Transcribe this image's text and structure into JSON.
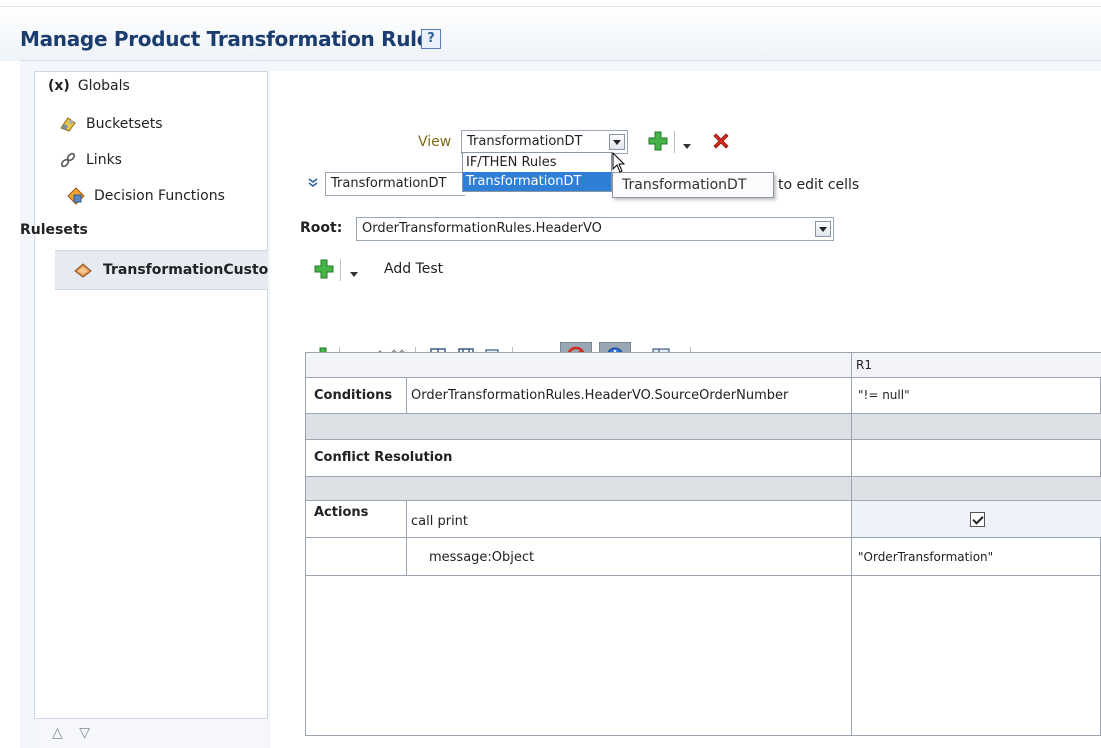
{
  "page": {
    "title": "Manage Product Transformation Rules",
    "help_label": "?"
  },
  "sidebar": {
    "items": [
      {
        "label": "Globals",
        "icon": "globals-icon"
      },
      {
        "label": "Bucketsets",
        "icon": "bucketsets-icon"
      },
      {
        "label": "Links",
        "icon": "links-icon"
      },
      {
        "label": "Decision Functions",
        "icon": "decision-functions-icon"
      }
    ],
    "rulesets_header": "Rulesets",
    "ruleset_item": "TransformationCusto",
    "globals_prefix": "(x)",
    "bottom_controls": "△ ▽"
  },
  "view": {
    "label": "View",
    "selected": "TransformationDT",
    "options": [
      "IF/THEN Rules",
      "TransformationDT"
    ],
    "tooltip": "TransformationDT"
  },
  "decision_table_bar": {
    "name": "TransformationDT",
    "hint": "to edit cells"
  },
  "root": {
    "label": "Root:",
    "value": "OrderTransformationRules.HeaderVO"
  },
  "tests": {
    "add_label": "Add Test"
  },
  "table": {
    "column_header": "R1",
    "conditions_label": "Conditions",
    "condition_expr": "OrderTransformationRules.HeaderVO.SourceOrderNumber",
    "condition_value": "\"!= null\"",
    "conflict_label": "Conflict Resolution",
    "actions_label": "Actions",
    "action_call": "call print",
    "action_checked": true,
    "param_label": "message:Object",
    "param_value": "\"OrderTransformation\""
  },
  "colors": {
    "title": "#1a3c6e",
    "green_add": "#3aa53a",
    "red_delete": "#d42a1e",
    "selected_option": "#2f7fd6"
  }
}
